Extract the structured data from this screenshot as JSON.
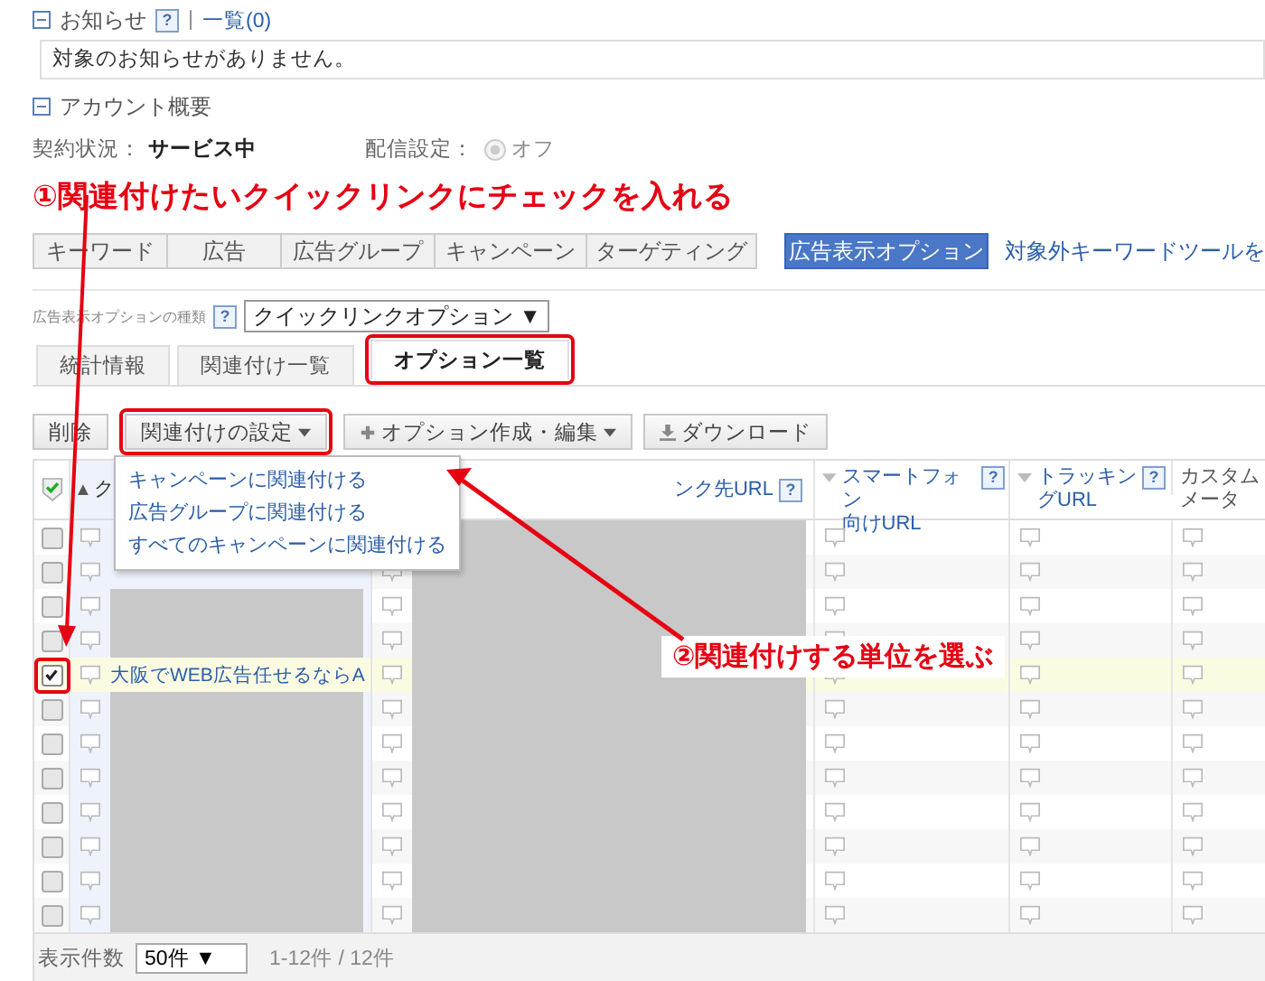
{
  "notices": {
    "expanded": true,
    "title": "お知らせ",
    "help": "?",
    "separator": "|",
    "list_link": "一覧(0)",
    "message": "対象のお知らせがありません。"
  },
  "account": {
    "expanded": true,
    "title": "アカウント概要",
    "contract_label": "契約状況：",
    "contract_value": "サービス中",
    "delivery_label": "配信設定：",
    "delivery_disabled": true,
    "delivery_value": "オフ"
  },
  "annotation_1": "①関連付けたいクイックリンクにチェックを入れる",
  "nav_tabs": [
    {
      "label": "キーワード",
      "selected": false
    },
    {
      "label": "広告",
      "selected": false
    },
    {
      "label": "広告グループ",
      "selected": false
    },
    {
      "label": "キャンペーン",
      "selected": false
    },
    {
      "label": "ターゲティング",
      "selected": false
    },
    {
      "label": "広告表示オプション",
      "selected": true
    }
  ],
  "nav_link": "対象外キーワードツールを",
  "option_type": {
    "label": "広告表示オプションの種類",
    "help": "?",
    "value": "クイックリンクオプション",
    "caret": "▼"
  },
  "sub_tabs": [
    {
      "label": "統計情報",
      "selected": false,
      "highlighted": false
    },
    {
      "label": "関連付け一覧",
      "selected": false,
      "highlighted": false
    },
    {
      "label": "オプション一覧",
      "selected": true,
      "highlighted": true
    }
  ],
  "toolbar": [
    {
      "kind": "plain",
      "label": "削除",
      "highlighted": false
    },
    {
      "kind": "menu",
      "label": "関連付けの設定",
      "highlighted": true
    },
    {
      "kind": "add-menu",
      "label": "オプション作成・編集",
      "highlighted": false
    },
    {
      "kind": "download",
      "label": "ダウンロード",
      "highlighted": false
    }
  ],
  "dropdown_menu": [
    "キャンペーンに関連付ける",
    "広告グループに関連付ける",
    "すべてのキャンペーンに関連付ける"
  ],
  "table": {
    "all_checked": true,
    "columns": [
      {
        "kind": "name",
        "sort": "▲",
        "lines": [
          "ク"
        ]
      },
      {
        "kind": "url",
        "lines": [
          "ンク先URL"
        ],
        "help": "?"
      },
      {
        "kind": "sp",
        "lines": [
          "スマートフォン",
          "向けURL"
        ],
        "help": "?"
      },
      {
        "kind": "tr",
        "lines": [
          "トラッキン",
          "グURL"
        ],
        "help": "?"
      },
      {
        "kind": "custom",
        "lines": [
          "カスタム",
          "メータ"
        ]
      }
    ],
    "rows": [
      {
        "checked": false,
        "highlighted": false,
        "name_masked": false,
        "url_masked": true
      },
      {
        "checked": false,
        "highlighted": false,
        "name_masked": false,
        "url_masked": true
      },
      {
        "checked": false,
        "highlighted": false,
        "name_masked": true,
        "url_masked": true
      },
      {
        "checked": false,
        "highlighted": false,
        "name_masked": true,
        "url_masked": true
      },
      {
        "checked": true,
        "highlighted": true,
        "name": "大阪でWEB広告任せるならA",
        "name_masked": false,
        "url_masked": true
      },
      {
        "checked": false,
        "highlighted": false,
        "name_masked": true,
        "url_masked": true
      },
      {
        "checked": false,
        "highlighted": false,
        "name_masked": true,
        "url_masked": true
      },
      {
        "checked": false,
        "highlighted": false,
        "name_masked": true,
        "url_masked": true
      },
      {
        "checked": false,
        "highlighted": false,
        "name_masked": true,
        "url_masked": true
      },
      {
        "checked": false,
        "highlighted": false,
        "name_masked": true,
        "url_masked": true
      },
      {
        "checked": false,
        "highlighted": false,
        "name_masked": true,
        "url_masked": true
      },
      {
        "checked": false,
        "highlighted": false,
        "name_masked": true,
        "url_masked": true
      }
    ]
  },
  "footer": {
    "label": "表示件数",
    "per_page": "50件",
    "caret": "▼",
    "range": "1-12件 / 12件"
  },
  "annotation_2": "②関連付けする単位を選ぶ"
}
